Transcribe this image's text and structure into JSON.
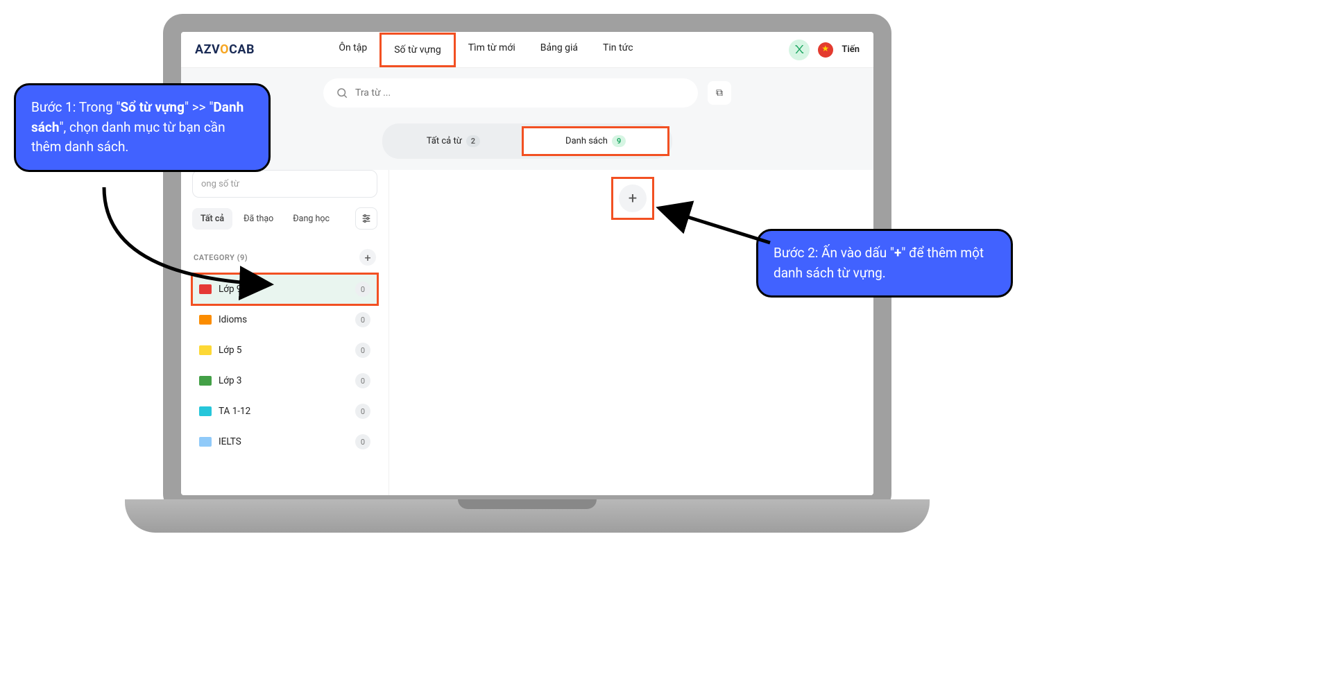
{
  "logo": {
    "prefix": "AZV",
    "suffix": "CAB"
  },
  "nav": {
    "items": [
      "Ôn tập",
      "Số từ vựng",
      "Tìm từ mới",
      "Bảng giá",
      "Tin tức"
    ],
    "highlighted_index": 1
  },
  "language": {
    "label": "Tiến"
  },
  "search": {
    "placeholder": "Tra từ ..."
  },
  "tabs": {
    "all": {
      "label": "Tất cả từ",
      "count": "2"
    },
    "list": {
      "label": "Danh sách",
      "count": "9"
    }
  },
  "sidebar": {
    "search_placeholder": "ong số từ",
    "filters": [
      "Tất cả",
      "Đã thạo",
      "Đang học"
    ],
    "category_header": "CATEGORY (9)",
    "categories": [
      {
        "name": "Lớp 9",
        "count": "0",
        "color": "#e53935",
        "selected": true
      },
      {
        "name": "Idioms",
        "count": "0",
        "color": "#fb8c00"
      },
      {
        "name": "Lớp 5",
        "count": "0",
        "color": "#fdd835"
      },
      {
        "name": "Lớp 3",
        "count": "0",
        "color": "#43a047"
      },
      {
        "name": "TA 1-12",
        "count": "0",
        "color": "#26c6da"
      },
      {
        "name": "IELTS",
        "count": "0",
        "color": "#90caf9"
      }
    ]
  },
  "callouts": {
    "step1": {
      "prefix": "Bước 1: Trong \"",
      "bold1": "Sổ từ vựng",
      "mid": "\" >> \"",
      "bold2": "Danh sách",
      "suffix": "\", chọn danh mục từ bạn cần thêm danh sách."
    },
    "step2": {
      "prefix": "Bước 2: Ấn vào dấu \"",
      "bold1": "+",
      "suffix": "\" để thêm một danh sách từ vựng."
    }
  }
}
